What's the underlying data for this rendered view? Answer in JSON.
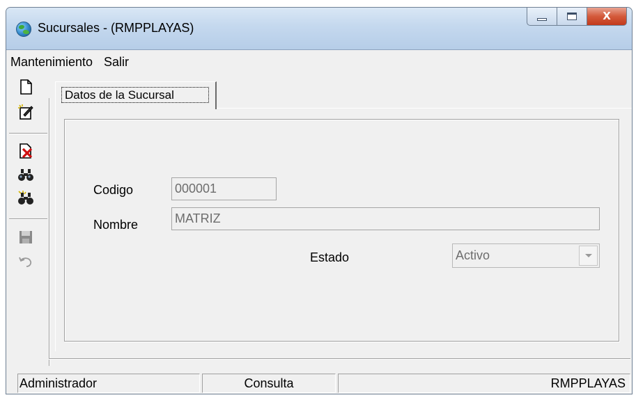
{
  "window": {
    "title": "Sucursales - (RMPPLAYAS)",
    "title_bar_color": "#c4d8ee",
    "close_button_color": "#c8452a",
    "caption_icons": [
      "minimize-icon",
      "maximize-icon",
      "close-icon"
    ],
    "close_glyph": "X"
  },
  "menu": {
    "items": [
      {
        "label": "Mantenimiento"
      },
      {
        "label": "Salir"
      }
    ]
  },
  "toolbar": {
    "icons": [
      "new-document-icon",
      "edit-document-icon",
      "delete-document-icon",
      "find-icon",
      "find-next-icon",
      "save-icon",
      "undo-icon"
    ]
  },
  "tabs": [
    {
      "label": "Datos de la Sucursal",
      "active": true
    }
  ],
  "form": {
    "codigo_label": "Codigo",
    "codigo_value": "000001",
    "nombre_label": "Nombre",
    "nombre_value": "MATRIZ",
    "estado_label": "Estado",
    "estado_value": "Activo"
  },
  "status": {
    "user": "Administrador",
    "mode": "Consulta",
    "company": "RMPPLAYAS"
  }
}
